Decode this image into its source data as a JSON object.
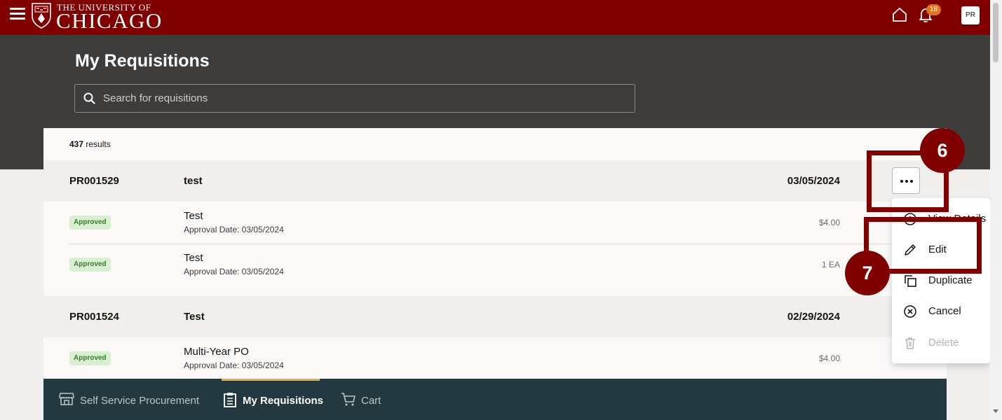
{
  "header": {
    "brand_top": "THE UNIVERSITY OF",
    "brand_main": "CHICAGO",
    "notification_count": "18",
    "avatar_initials": "PR"
  },
  "page": {
    "title": "My Requisitions",
    "search_placeholder": "Search for requisitions",
    "results_count": "437",
    "results_label": "results"
  },
  "requisitions": [
    {
      "id": "PR001529",
      "name": "test",
      "date": "03/05/2024",
      "lines": [
        {
          "status": "Approved",
          "description": "Test",
          "approval_date": "Approval Date: 03/05/2024",
          "amount": "$4.00"
        },
        {
          "status": "Approved",
          "description": "Test",
          "approval_date": "Approval Date: 03/05/2024",
          "amount": "1 EA"
        }
      ]
    },
    {
      "id": "PR001524",
      "name": "Test",
      "date": "02/29/2024",
      "lines": [
        {
          "status": "Approved",
          "description": "Multi-Year PO",
          "approval_date": "Approval Date: 03/05/2024",
          "amount": "$4.00"
        }
      ]
    }
  ],
  "actions_menu": {
    "items": [
      {
        "label": "View Details",
        "icon": "view-icon",
        "enabled": true
      },
      {
        "label": "Edit",
        "icon": "pencil-icon",
        "enabled": true
      },
      {
        "label": "Duplicate",
        "icon": "duplicate-icon",
        "enabled": true
      },
      {
        "label": "Cancel",
        "icon": "cancel-circle-icon",
        "enabled": true
      },
      {
        "label": "Delete",
        "icon": "trash-icon",
        "enabled": false
      }
    ]
  },
  "callouts": {
    "step_6": "6",
    "step_7": "7"
  },
  "bottom_nav": {
    "items": [
      {
        "label": "Self Service Procurement",
        "icon": "storefront-icon",
        "active": false
      },
      {
        "label": "My Requisitions",
        "icon": "clipboard-icon",
        "active": true
      },
      {
        "label": "Cart",
        "icon": "cart-icon",
        "active": false
      }
    ]
  },
  "colors": {
    "brand_maroon": "#800000",
    "hero_dark": "#3f3d3b",
    "bottom_nav_bg": "#23393f",
    "approved_badge_bg": "#d7f0cf",
    "notification_orange": "#e07420",
    "active_tab_underline": "#e3b341"
  }
}
